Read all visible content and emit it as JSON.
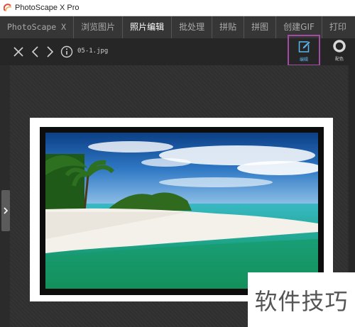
{
  "app": {
    "title": "PhotoScape X Pro"
  },
  "menu": {
    "items": [
      {
        "label": "PhotoScape X"
      },
      {
        "label": "浏览图片"
      },
      {
        "label": "照片编辑"
      },
      {
        "label": "批处理"
      },
      {
        "label": "拼贴"
      },
      {
        "label": "拼图"
      },
      {
        "label": "创建GIF"
      },
      {
        "label": "打印"
      }
    ],
    "active": "照片编辑"
  },
  "toolbar": {
    "filename": "05-1.jpg",
    "edit_label": "编辑",
    "color_label": "配色",
    "edit_highlight_color": "#a24ba5",
    "edit_label_color": "#58b7f0"
  },
  "icons": {
    "close": "close-icon",
    "prev": "chevron-left-icon",
    "next": "chevron-right-icon",
    "info": "info-icon",
    "edit": "edit-pencil-icon",
    "color": "ring-icon",
    "expand": "chevron-right-icon"
  },
  "watermark": {
    "text": "软件技巧"
  }
}
